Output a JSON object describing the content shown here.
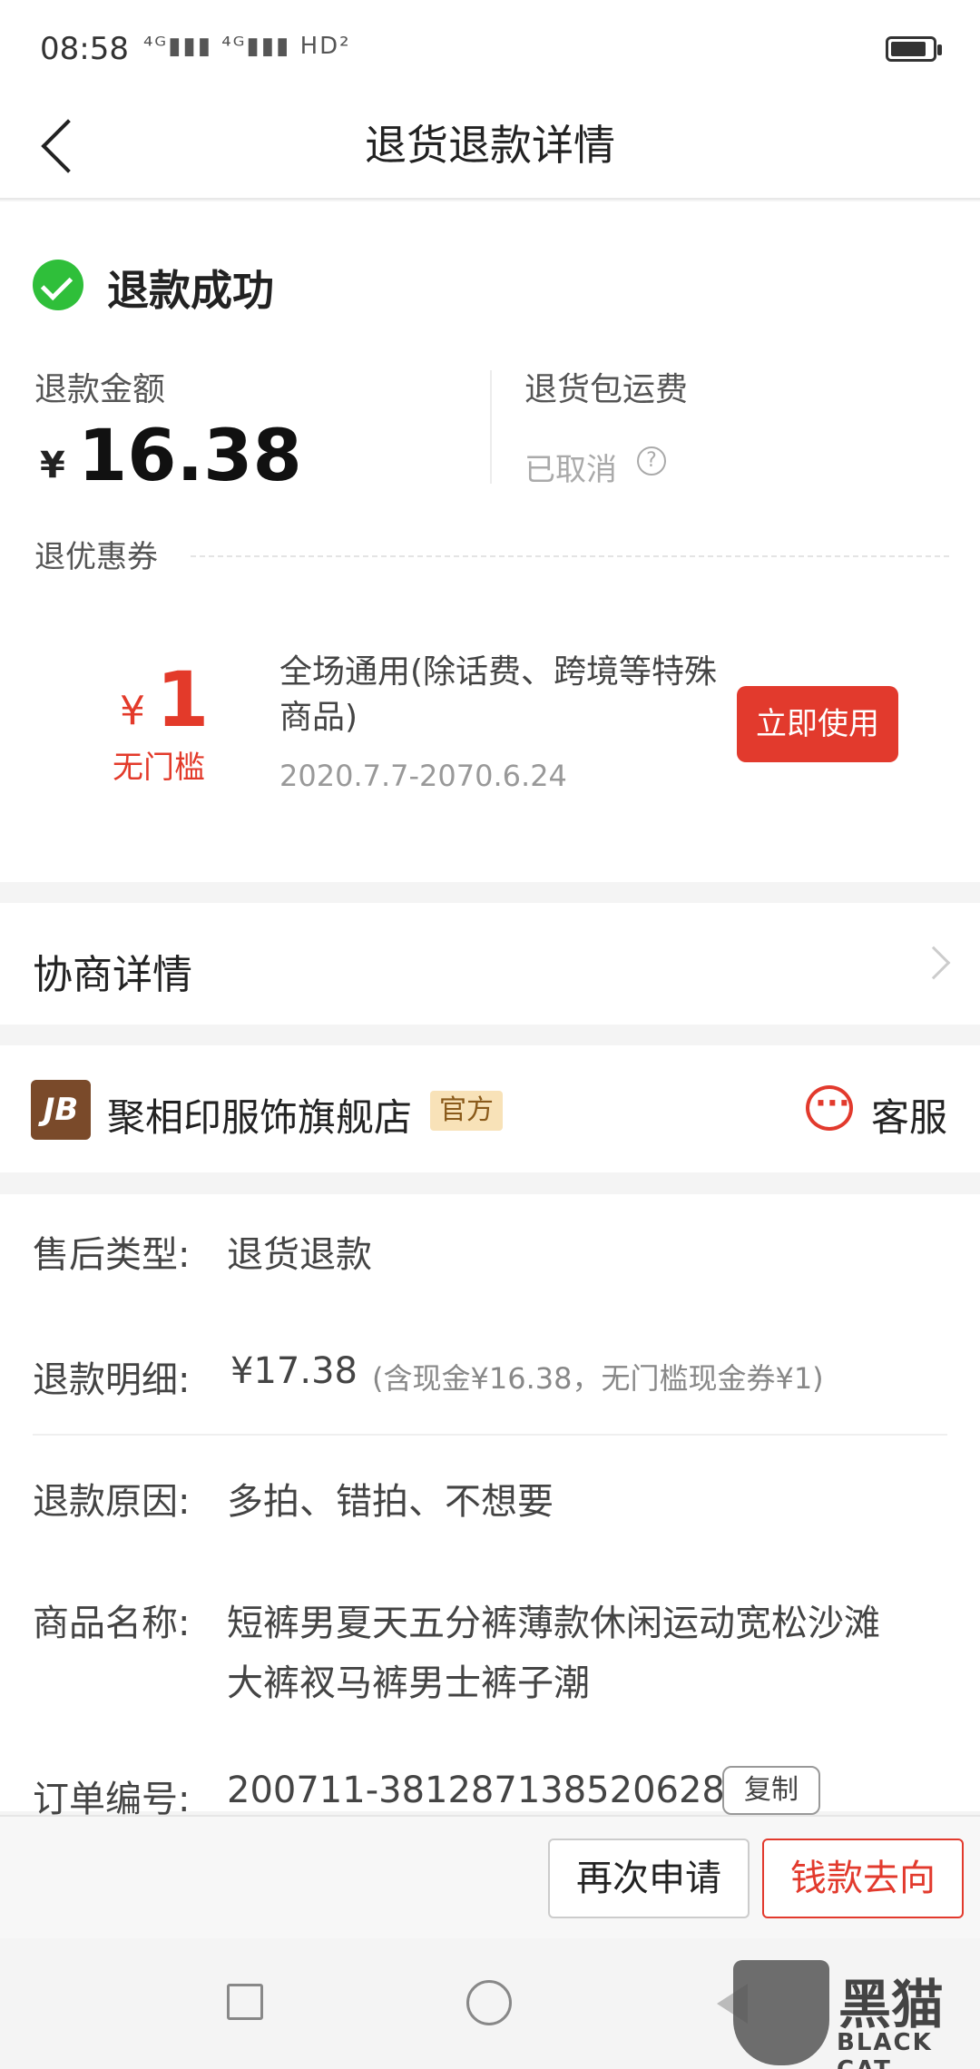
{
  "status_bar": {
    "time": "08:58",
    "signal": "⁴ᴳ▮▮▮ ⁴ᴳ▮▮▮ HD²"
  },
  "nav": {
    "title": "退货退款详情"
  },
  "refund": {
    "status": "退款成功",
    "amount_label": "退款金额",
    "amount_currency": "¥",
    "amount_value": "16.38",
    "shipping_label": "退货包运费",
    "shipping_status": "已取消",
    "coupon_section_label": "退优惠券"
  },
  "coupon": {
    "currency": "¥",
    "amount": "1",
    "condition": "无门槛",
    "description": "全场通用(除话费、跨境等特殊商品)",
    "validity": "2020.7.7-2070.6.24",
    "use_button": "立即使用"
  },
  "negotiation": {
    "label": "协商详情"
  },
  "shop": {
    "logo_text": "JB",
    "name": "聚相印服饰旗舰店",
    "badge": "官方",
    "service_label": "客服"
  },
  "details": {
    "type_key": "售后类型:",
    "type_val": "退货退款",
    "breakdown_key": "退款明细:",
    "breakdown_val": "¥17.38",
    "breakdown_note": "(含现金¥16.38，无门槛现金券¥1)",
    "reason_key": "退款原因:",
    "reason_val": "多拍、错拍、不想要",
    "product_key": "商品名称:",
    "product_line1": "短裤男夏天五分裤薄款休闲运动宽松沙滩",
    "product_line2": "大裤衩马裤男士裤子潮",
    "order_key": "订单编号:",
    "order_val": "200711-381287138520628",
    "copy_button": "复制"
  },
  "actions": {
    "reapply": "再次申请",
    "money_flow": "钱款去向"
  },
  "watermark": {
    "text": "黑猫",
    "sub": "BLACK CAT"
  },
  "colors": {
    "accent": "#e23a2d",
    "success": "#2fbf3a",
    "badge_bg": "#f8e2b8"
  }
}
